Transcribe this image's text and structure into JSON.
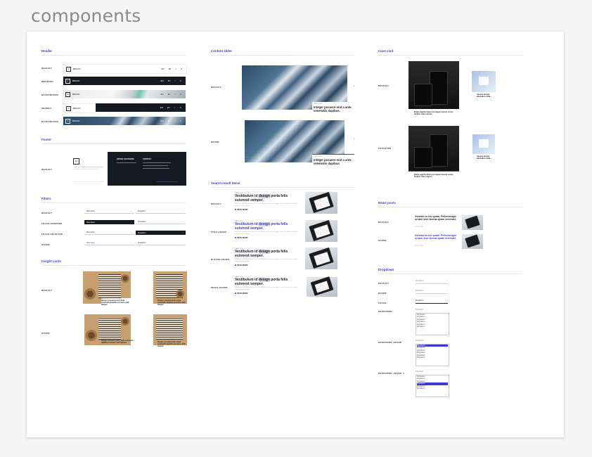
{
  "page_title": "components",
  "colors": {
    "accent": "#3c3ad6",
    "dark": "#151a22",
    "frame_bg": "#ffffff",
    "canvas_bg": "#f5f5f6"
  },
  "header": {
    "title": "Header",
    "variants": [
      "DEFAULT",
      "INVERTED",
      "BACKGROUND",
      "SEARCH",
      "BACKGROUND"
    ],
    "nav": [
      "EN",
      "ET",
      "Q"
    ],
    "logo_text": "BRAND"
  },
  "footer": {
    "title": "Footer",
    "variant": "DEFAULT",
    "col1": "OFFICE LOCATIONS",
    "col2": "CONTACT"
  },
  "filters": {
    "title": "Filters",
    "variants": [
      "DEFAULT",
      "FOCUS INVERTED",
      "FOCUS SELECTED",
      "HOVER"
    ],
    "left_value": "Filter label",
    "right_value": "Dropdown"
  },
  "insight_cards": {
    "title": "Insight cards",
    "variants": [
      "DEFAULT",
      "HOVER"
    ],
    "card_text": "Integer posuere erat a ante venenatis dapibus posuere velit aliquet.",
    "small_text": "Integer posuere erat a ante venenatis dapibus posuere velit aliquet."
  },
  "content_slider": {
    "title": "Content slider",
    "variants": [
      "DEFAULT",
      "HOVER"
    ],
    "eyebrow": "CATEGORY",
    "caption": "Integer posuere erat a ante venenatis dapibus."
  },
  "search_results": {
    "title": "Search result items",
    "variants": [
      "DEFAULT",
      "TITLE HOVER",
      "BUTTON HOVER",
      "IMAGE HOVER"
    ],
    "eyebrow": "CATEGORY",
    "heading_pre": "Vestibulum id ",
    "heading_hl": "design",
    "heading_post": " porta felis euismod semper.",
    "body": "Maecenas sed diam eget risus varius blandit sit amet non magna. Donec id elit non mi porta gravida at eget metus.",
    "link": "READ MORE"
  },
  "case_card": {
    "title": "Case card",
    "variants": [
      "DEFAULT",
      "FOCUSSED"
    ],
    "caption": "Etiam sagittis fames vel augue laoreet ornare facilisis dolor auctor.",
    "side_caption": "Aenean lacinia bibendum nulla"
  },
  "news_posts": {
    "title": "News posts",
    "variants": [
      "DEFAULT",
      "HOVER"
    ],
    "heading": "Aenean eu leo quam. Pellentesque ornare sem lacinia quam venenatl.",
    "date": "12.05.2019"
  },
  "dropdown": {
    "title": "Dropdown",
    "variants": [
      "DEFAULT",
      "HOVER",
      "FOCUS",
      "DROPDOWN",
      "DROPDOWN_HOVER",
      "DROPDOWN_HOVER_2"
    ],
    "placeholder": "Dropdown",
    "options": [
      "Dropdown",
      "Dropdown",
      "Dropdown",
      "Dropdown",
      "Dropdown",
      "Dropdown"
    ]
  }
}
